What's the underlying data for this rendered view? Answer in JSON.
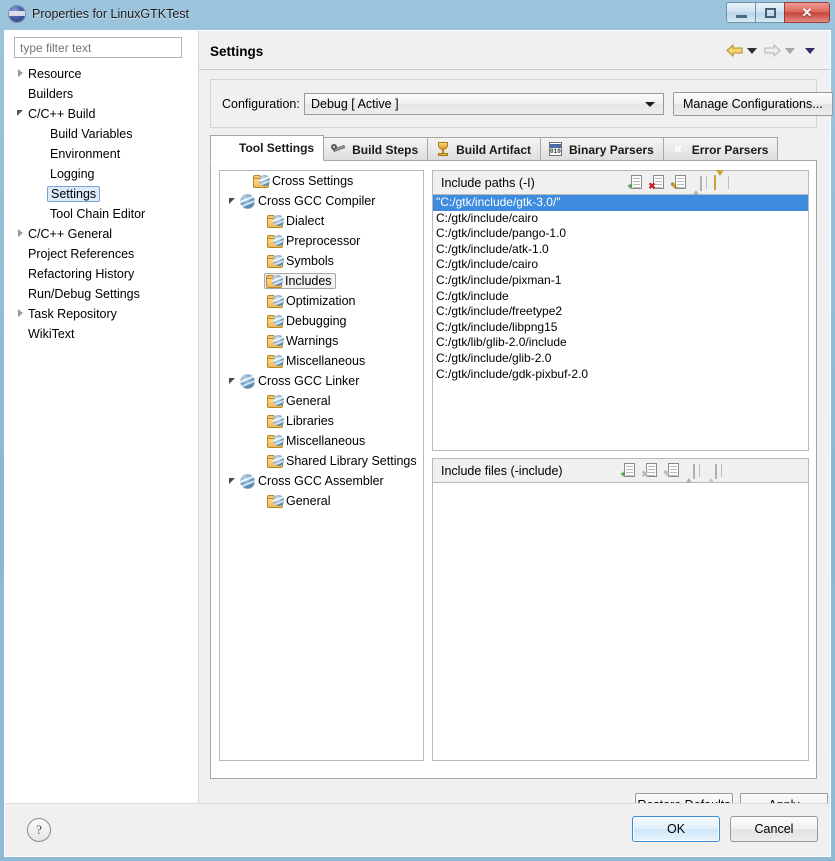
{
  "window": {
    "title": "Properties for LinuxGTKTest",
    "app_icon": "eclipse-icon",
    "minimize_label": "",
    "maximize_label": "",
    "close_label": "✕",
    "titlebar_color": "#8cb8d4",
    "close_color": "#c8443a"
  },
  "filter": {
    "placeholder": "type filter text",
    "value": ""
  },
  "nav_tree": [
    {
      "label": "Resource",
      "indent": 0,
      "arrow": "closed",
      "selected": false
    },
    {
      "label": "Builders",
      "indent": 0,
      "arrow": "none",
      "selected": false
    },
    {
      "label": "C/C++ Build",
      "indent": 0,
      "arrow": "open",
      "selected": false
    },
    {
      "label": "Build Variables",
      "indent": 1,
      "arrow": "none",
      "selected": false
    },
    {
      "label": "Environment",
      "indent": 1,
      "arrow": "none",
      "selected": false
    },
    {
      "label": "Logging",
      "indent": 1,
      "arrow": "none",
      "selected": false
    },
    {
      "label": "Settings",
      "indent": 1,
      "arrow": "none",
      "selected": true
    },
    {
      "label": "Tool Chain Editor",
      "indent": 1,
      "arrow": "none",
      "selected": false
    },
    {
      "label": "C/C++ General",
      "indent": 0,
      "arrow": "closed",
      "selected": false
    },
    {
      "label": "Project References",
      "indent": 0,
      "arrow": "none",
      "selected": false
    },
    {
      "label": "Refactoring History",
      "indent": 0,
      "arrow": "none",
      "selected": false
    },
    {
      "label": "Run/Debug Settings",
      "indent": 0,
      "arrow": "none",
      "selected": false
    },
    {
      "label": "Task Repository",
      "indent": 0,
      "arrow": "closed",
      "selected": false
    },
    {
      "label": "WikiText",
      "indent": 0,
      "arrow": "none",
      "selected": false
    }
  ],
  "page": {
    "title": "Settings",
    "back_icon": "back-arrow-icon",
    "forward_icon": "forward-arrow-icon",
    "menu_icon": "chevron-down-icon"
  },
  "configuration": {
    "label": "Configuration:",
    "selected": "Debug  [ Active ]",
    "options": [
      "Debug  [ Active ]"
    ],
    "manage_button": "Manage Configurations..."
  },
  "tabs": [
    {
      "label": "Tool Settings",
      "icon": "tool-settings-icon",
      "active": true
    },
    {
      "label": "Build Steps",
      "icon": "wrench-icon",
      "active": false
    },
    {
      "label": "Build Artifact",
      "icon": "trophy-icon",
      "active": false
    },
    {
      "label": "Binary Parsers",
      "icon": "binary-file-icon",
      "active": false
    },
    {
      "label": "Error Parsers",
      "icon": "error-icon",
      "active": false
    }
  ],
  "tool_tree": [
    {
      "label": "Cross Settings",
      "indent": 1,
      "arrow": "none",
      "icon": "folder-icon",
      "selected": false
    },
    {
      "label": "Cross GCC Compiler",
      "indent": 0,
      "arrow": "open",
      "icon": "tool-icon",
      "selected": false
    },
    {
      "label": "Dialect",
      "indent": 2,
      "arrow": "none",
      "icon": "folder-icon",
      "selected": false
    },
    {
      "label": "Preprocessor",
      "indent": 2,
      "arrow": "none",
      "icon": "folder-icon",
      "selected": false
    },
    {
      "label": "Symbols",
      "indent": 2,
      "arrow": "none",
      "icon": "folder-icon",
      "selected": false
    },
    {
      "label": "Includes",
      "indent": 2,
      "arrow": "none",
      "icon": "folder-icon",
      "selected": true
    },
    {
      "label": "Optimization",
      "indent": 2,
      "arrow": "none",
      "icon": "folder-icon",
      "selected": false
    },
    {
      "label": "Debugging",
      "indent": 2,
      "arrow": "none",
      "icon": "folder-icon",
      "selected": false
    },
    {
      "label": "Warnings",
      "indent": 2,
      "arrow": "none",
      "icon": "folder-icon",
      "selected": false
    },
    {
      "label": "Miscellaneous",
      "indent": 2,
      "arrow": "none",
      "icon": "folder-icon",
      "selected": false
    },
    {
      "label": "Cross GCC Linker",
      "indent": 0,
      "arrow": "open",
      "icon": "tool-icon",
      "selected": false
    },
    {
      "label": "General",
      "indent": 2,
      "arrow": "none",
      "icon": "folder-icon",
      "selected": false
    },
    {
      "label": "Libraries",
      "indent": 2,
      "arrow": "none",
      "icon": "folder-icon",
      "selected": false
    },
    {
      "label": "Miscellaneous",
      "indent": 2,
      "arrow": "none",
      "icon": "folder-icon",
      "selected": false
    },
    {
      "label": "Shared Library Settings",
      "indent": 2,
      "arrow": "none",
      "icon": "folder-icon",
      "selected": false
    },
    {
      "label": "Cross GCC Assembler",
      "indent": 0,
      "arrow": "open",
      "icon": "tool-icon",
      "selected": false
    },
    {
      "label": "General",
      "indent": 2,
      "arrow": "none",
      "icon": "folder-icon",
      "selected": false
    }
  ],
  "include_paths": {
    "title": "Include paths (-I)",
    "toolbar": [
      {
        "name": "add-icon",
        "badge": "+"
      },
      {
        "name": "delete-icon",
        "badge": "✖"
      },
      {
        "name": "edit-icon",
        "badge": "✎"
      },
      {
        "name": "move-up-icon",
        "badge": "↑"
      },
      {
        "name": "move-down-icon",
        "badge": "↓"
      }
    ],
    "items": [
      "\"C:/gtk/include/gtk-3.0/\"",
      "C:/gtk/include/cairo",
      "C:/gtk/include/pango-1.0",
      "C:/gtk/include/atk-1.0",
      "C:/gtk/include/cairo",
      "C:/gtk/include/pixman-1",
      "C:/gtk/include",
      "C:/gtk/include/freetype2",
      "C:/gtk/include/libpng15",
      "C:/gtk/lib/glib-2.0/include",
      "C:/gtk/include/glib-2.0",
      "C:/gtk/include/gdk-pixbuf-2.0"
    ],
    "selected_index": 0,
    "selection_color": "#3d8ce0"
  },
  "include_files": {
    "title": "Include files (-include)",
    "toolbar": [
      {
        "name": "add-icon",
        "badge": "+"
      },
      {
        "name": "delete-icon",
        "badge": "✖"
      },
      {
        "name": "edit-icon",
        "badge": "✎"
      },
      {
        "name": "move-up-icon",
        "badge": "↑"
      },
      {
        "name": "move-down-icon",
        "badge": "↓"
      }
    ],
    "items": []
  },
  "page_buttons": {
    "restore_defaults": "Restore Defaults",
    "apply": "Apply"
  },
  "dialog_buttons": {
    "help": "?",
    "ok": "OK",
    "cancel": "Cancel"
  }
}
